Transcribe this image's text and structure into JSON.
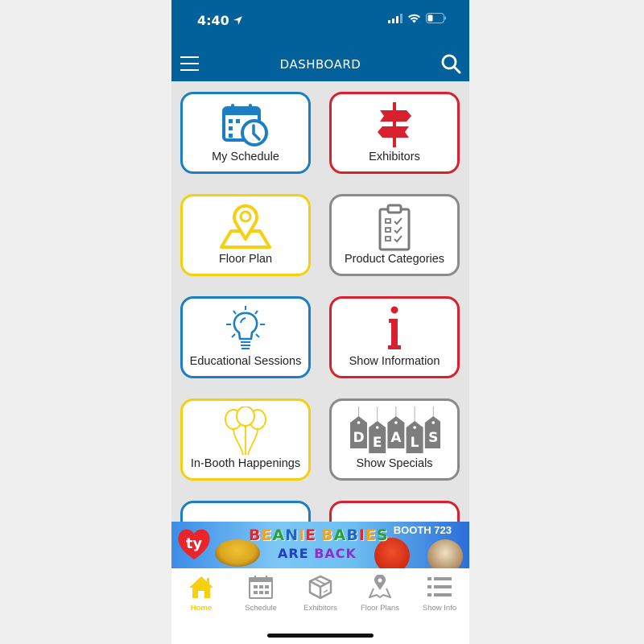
{
  "status_bar": {
    "time": "4:40",
    "location_icon": "location-arrow-icon",
    "signal_icon": "cellular-signal-icon",
    "wifi_icon": "wifi-icon",
    "battery_icon": "battery-low-icon"
  },
  "header": {
    "title": "DASHBOARD",
    "menu_icon": "hamburger-menu-icon",
    "search_icon": "search-icon",
    "background_color": "#02609a"
  },
  "tiles": [
    {
      "label": "My Schedule",
      "icon": "calendar-clock-icon",
      "color": "#1b7fc2"
    },
    {
      "label": "Exhibitors",
      "icon": "signpost-icon",
      "color": "#d8202f"
    },
    {
      "label": "Floor Plan",
      "icon": "map-pin-icon",
      "color": "#f6cf0f"
    },
    {
      "label": "Product Categories",
      "icon": "clipboard-checklist-icon",
      "color": "#8a8a8a"
    },
    {
      "label": "Educational Sessions",
      "icon": "lightbulb-icon",
      "color": "#1b7fc2"
    },
    {
      "label": "Show Information",
      "icon": "info-icon",
      "color": "#d8202f"
    },
    {
      "label": "In-Booth Happenings",
      "icon": "balloons-icon",
      "color": "#f6cf0f"
    },
    {
      "label": "Show Specials",
      "icon": "deals-tags-icon",
      "color": "#8a8a8a",
      "tag_letters": [
        "D",
        "E",
        "A",
        "L",
        "S"
      ]
    },
    {
      "label": "",
      "icon": "statue-of-liberty-icon",
      "color": "#1b7fc2"
    },
    {
      "label": "",
      "icon": "partial-red-icon",
      "color": "#d8202f"
    }
  ],
  "banner": {
    "brand": "ty",
    "title": "BEANIE BABIES",
    "subtitle_1": "ARE",
    "subtitle_2": "BACK",
    "booth": "BOOTH 723",
    "title_letter_colors": [
      "#e8252b",
      "#f7a21b",
      "#2b9f3c",
      "#1e63c8",
      "#f7a21b",
      "#e8252b",
      "#f7a21b",
      "#2b9f3c",
      "#1e63c8",
      "#e8252b",
      "#f7a21b",
      "#2b9f3c",
      "#8b2fc9"
    ]
  },
  "tabbar": {
    "items": [
      {
        "label": "Home",
        "icon": "home-icon",
        "active": true
      },
      {
        "label": "Schedule",
        "icon": "calendar-icon",
        "active": false
      },
      {
        "label": "Exhibitors",
        "icon": "box-icon",
        "active": false
      },
      {
        "label": "Floor Plans",
        "icon": "map-icon",
        "active": false
      },
      {
        "label": "Show Info",
        "icon": "list-icon",
        "active": false
      }
    ],
    "active_color": "#f6cf0f",
    "inactive_color": "#8e8e8e"
  }
}
